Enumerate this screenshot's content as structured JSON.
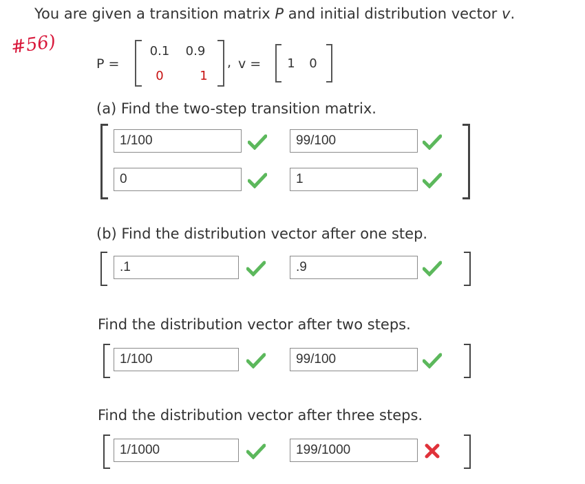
{
  "intro": {
    "prefix": "You are given a transition matrix ",
    "p": "P",
    "middle": " and initial distribution vector ",
    "v": "v",
    "suffix": "."
  },
  "handnote": "#56)",
  "math": {
    "p_label": "P =",
    "p_matrix": [
      [
        "0.1",
        "0.9"
      ],
      [
        "0",
        "1"
      ]
    ],
    "sep": ",",
    "v_label": "v =",
    "v_vector": [
      "1",
      "0"
    ]
  },
  "parts": {
    "a": {
      "question": "(a) Find the two-step transition matrix.",
      "answers": [
        [
          "1/100",
          "99/100"
        ],
        [
          "0",
          "1"
        ]
      ],
      "status": [
        [
          "correct",
          "correct"
        ],
        [
          "correct",
          "correct"
        ]
      ]
    },
    "b": {
      "question": "(b) Find the distribution vector after one step.",
      "answers": [
        ".1",
        ".9"
      ],
      "status": [
        "correct",
        "correct"
      ]
    },
    "c": {
      "question": "Find the distribution vector after two steps.",
      "answers": [
        "1/100",
        "99/100"
      ],
      "status": [
        "correct",
        "correct"
      ]
    },
    "d": {
      "question": "Find the distribution vector after three steps.",
      "answers": [
        "1/1000",
        "199/1000"
      ],
      "status": [
        "correct",
        "incorrect"
      ]
    }
  },
  "colors": {
    "correct": "#5cb85c",
    "incorrect": "#e0323a",
    "red_entry": "#c71212"
  }
}
